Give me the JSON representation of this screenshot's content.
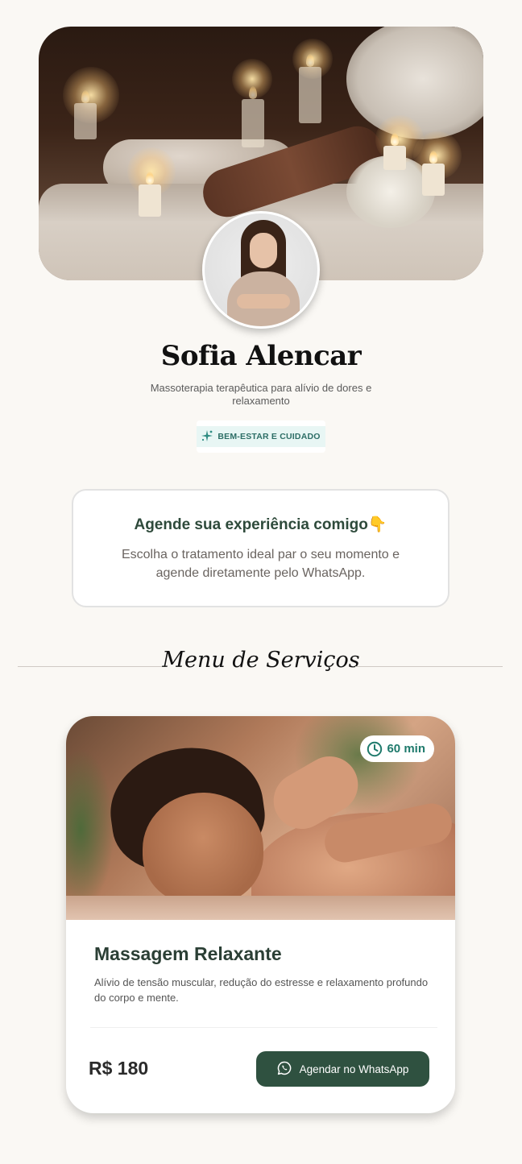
{
  "profile": {
    "name": "Sofia Alencar",
    "subtitle": "Massoterapia terapêutica para alívio de dores e relaxamento",
    "badge_icon": "sparkle-icon",
    "badge": "BEM-ESTAR E CUIDADO"
  },
  "cta": {
    "title": "Agende sua experiência comigo",
    "title_icon": "👇",
    "description": "Escolha o tratamento ideal par o seu momento e agende diretamente pelo WhatsApp."
  },
  "section": {
    "title": "Menu de Serviços"
  },
  "services": [
    {
      "duration_icon": "clock-icon",
      "duration": "60 min",
      "title": "Massagem Relaxante",
      "description": "Alívio de tensão muscular, redução do estresse e relaxamento profundo do corpo e mente.",
      "price": "R$ 180",
      "button_icon": "whatsapp-icon",
      "button_label": "Agendar no WhatsApp"
    }
  ],
  "colors": {
    "background": "#faf8f4",
    "primary_green": "#2f5140",
    "accent_teal": "#1f7a6c",
    "badge_bg": "#e8f6f4"
  }
}
